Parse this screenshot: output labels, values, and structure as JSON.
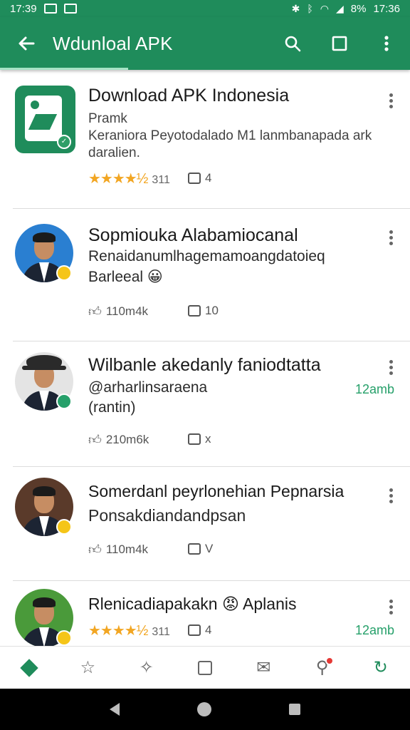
{
  "status_bar": {
    "time_left": "17:39",
    "battery": "8%",
    "time_right": "17:36"
  },
  "app_bar": {
    "title": "Wdunloal APK",
    "back_icon": "arrow-left-icon",
    "search_icon": "search-icon",
    "square_icon": "square-icon",
    "more_icon": "more-vert-icon"
  },
  "items": [
    {
      "title": "Download APK Indonesia",
      "line1": "Pramk",
      "line2": "Keraniora Peyotodalado M1 lanmbanapada ark",
      "line3": "daralien.",
      "rating_stars": "★★★★½",
      "rating_count": "311",
      "share_count": "4"
    },
    {
      "title": "Sopmiouka Alabamiocanal",
      "line1": "Renaidanumlhagemamoangdatoieq",
      "line2": "Barleeal 😀",
      "likes": "110m4k",
      "comments": "10"
    },
    {
      "title": "Wilbanle akedanly faniodtatta",
      "line1": "@arharlinsaraena",
      "line2": "(rantin)",
      "time": "12amb",
      "likes": "210m6k",
      "comments": "x"
    },
    {
      "title": "Somerdanl peyrlonehian Pepnarsia",
      "line1": "Ponsakdiandandpsan",
      "likes": "110m4k",
      "comments": "V"
    },
    {
      "title": "Rlenicadiapakakn 😡 Aplanis",
      "rating_stars": "★★★★½",
      "rating_count": "311",
      "share_count": "4",
      "time": "12amb"
    }
  ],
  "colors": {
    "primary": "#1f8c5b",
    "accent_text": "#26a06a",
    "star": "#f2a623"
  },
  "bottom_nav": [
    "home-diamond-icon",
    "star-icon",
    "pin-icon",
    "inbox-icon",
    "mail-icon",
    "mic-icon",
    "refresh-icon"
  ]
}
